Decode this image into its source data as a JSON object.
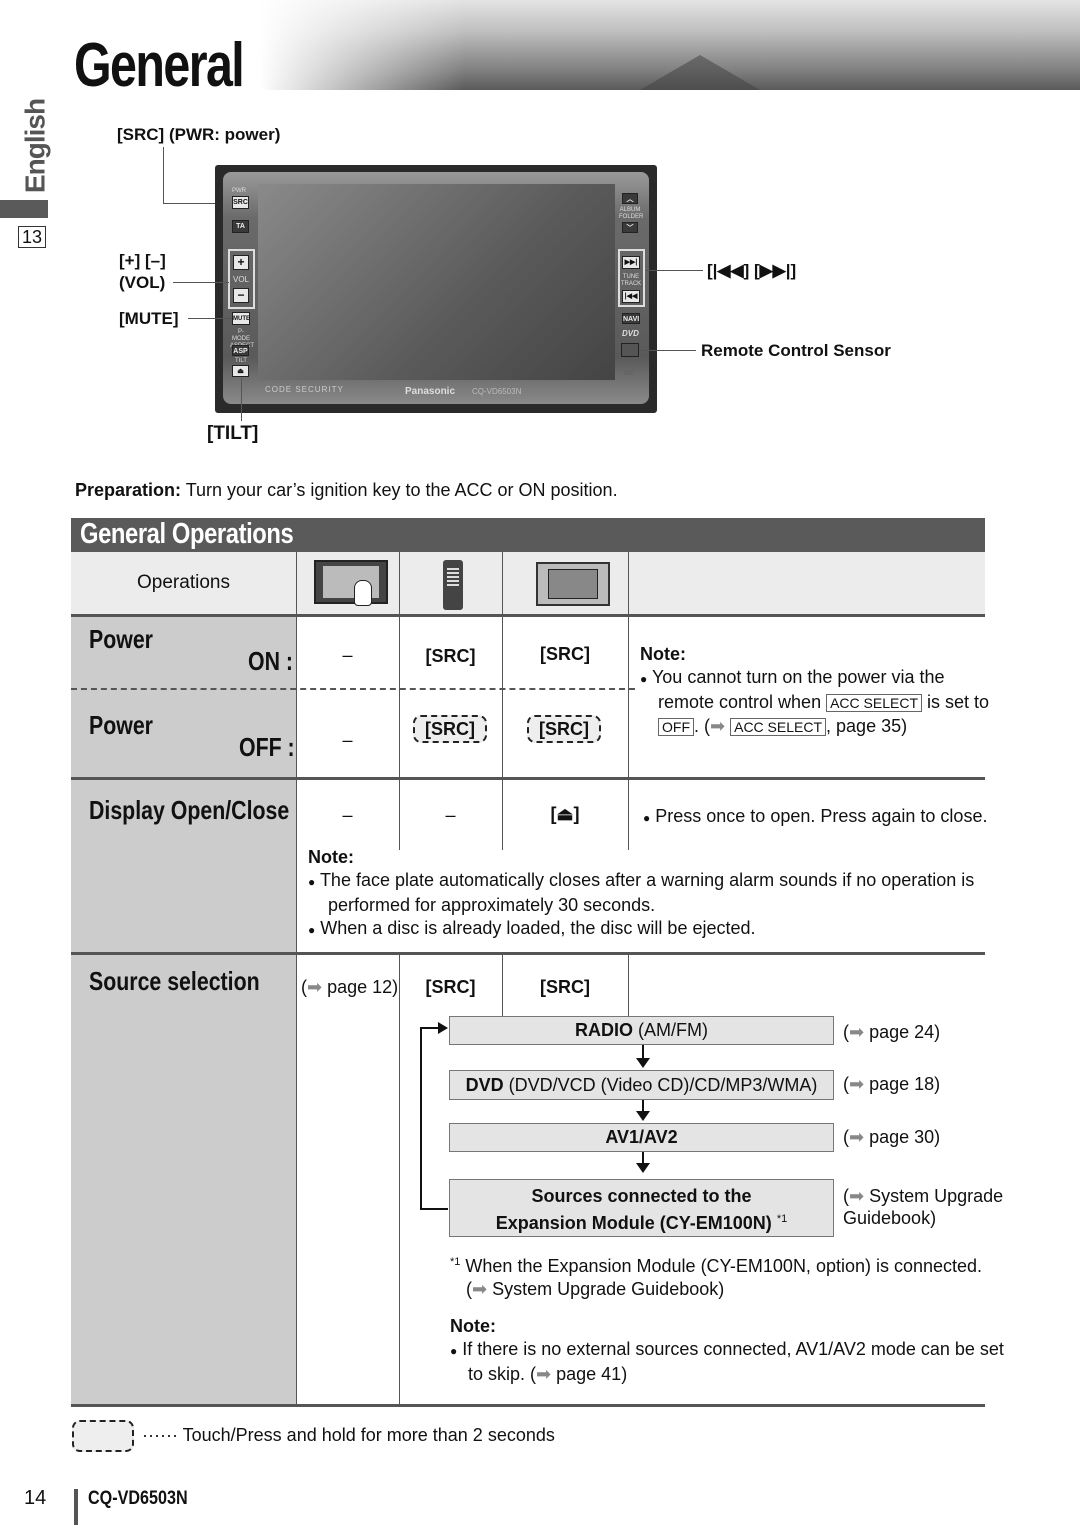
{
  "page": {
    "title": "General",
    "language_tab": "English",
    "index_number": "13",
    "page_number": "14",
    "model": "CQ-VD6503N"
  },
  "device_diagram": {
    "callouts": {
      "src": "[SRC] (PWR: power)",
      "vol": "[+] [–]",
      "vol_sub": "(VOL)",
      "mute": "[MUTE]",
      "tilt": "[TILT]",
      "track": "[|◀◀] [▶▶|]",
      "sensor": "Remote Control Sensor"
    },
    "buttons": {
      "pwr": "PWR",
      "src": "SRC",
      "ta": "TA",
      "plus": "+",
      "vol": "VOL",
      "minus": "−",
      "mute": "MUTE",
      "pmode": "P-MODE ASPECT",
      "asp": "ASP",
      "tilt": "TILT",
      "eject": "⏏",
      "up": "︿",
      "album": "ALBUM FOLDER",
      "down": "﹀",
      "next": "▶▶|",
      "tune": "TUNE TRACK",
      "prev": "|◀◀",
      "navi": "NAVI",
      "dvd": "DVD"
    },
    "brand": "Panasonic",
    "model": "CQ-VD6503N",
    "code_security": "CODE SECURITY"
  },
  "preparation": {
    "label": "Preparation:",
    "text": " Turn your car’s ignition key to the ACC or ON position."
  },
  "section": {
    "title": "General Operations",
    "header": {
      "operations": "Operations",
      "icons": [
        "touch-panel-icon",
        "remote-control-icon",
        "unit-panel-icon"
      ]
    },
    "rows": {
      "power_on": {
        "label": "Power",
        "sub": "ON :",
        "touch": "–",
        "remote": "[SRC]",
        "unit": "[SRC]"
      },
      "power_off": {
        "label": "Power",
        "sub": "OFF :",
        "touch": "–",
        "remote": "[SRC]",
        "unit": "[SRC]"
      },
      "power_note": {
        "title": "Note:",
        "line1": "You cannot turn on the power via the",
        "line2a": "remote control when ",
        "acc1": "ACC SELECT",
        "line2b": " is set to",
        "off": "OFF",
        "line3a": ". (",
        "acc2": "ACC SELECT",
        "line3b": ", page 35)"
      },
      "display": {
        "label": "Display Open/Close",
        "touch": "–",
        "remote": "–",
        "unit": "[⏏]",
        "desc": "Press once to open. Press again to close.",
        "note_title": "Note:",
        "note1a": "The face plate automatically closes after a warning alarm sounds if no operation is",
        "note1b": "performed for approximately 30 seconds.",
        "note2": "When a disc is already loaded, the disc will be ejected."
      },
      "source": {
        "label": "Source selection",
        "touch": "page 12)",
        "remote": "[SRC]",
        "unit": "[SRC]",
        "flow": [
          {
            "bold": "RADIO",
            "rest": " (AM/FM)",
            "ref": "page 24)"
          },
          {
            "bold": "DVD",
            "rest": " (DVD/VCD (Video CD)/CD/MP3/WMA)",
            "ref": "page 18)"
          },
          {
            "bold": "AV1/AV2",
            "rest": "",
            "ref": "page 30)"
          },
          {
            "bold": "Sources connected to the",
            "bold2": "Expansion Module (CY-EM100N)",
            "sup": "*1",
            "ref": "System Upgrade",
            "ref2": "Guidebook)"
          }
        ],
        "footnote_mark": "*1",
        "footnote1": "When the Expansion Module (CY-EM100N, option) is connected.",
        "footnote2": "System Upgrade Guidebook)",
        "note_title": "Note:",
        "note1": "If there is no external sources connected, AV1/AV2 mode can be set",
        "note2": "to skip. (",
        "note2b": " page 41)"
      }
    }
  },
  "legend": {
    "text": "······ Touch/Press and hold for more than 2 seconds"
  },
  "symbols": {
    "arrow": "➡",
    "bullet": "●",
    "open_paren": "("
  }
}
